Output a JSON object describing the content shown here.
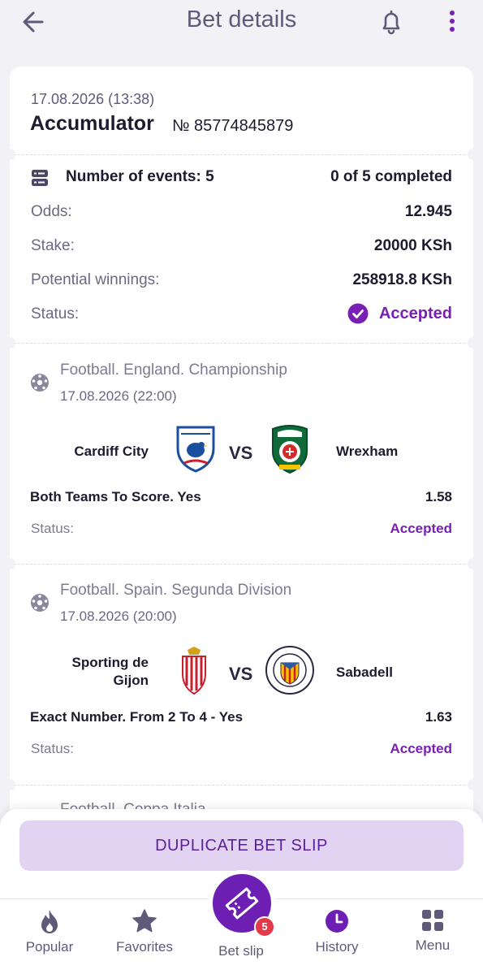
{
  "header": {
    "title": "Bet details"
  },
  "bet": {
    "datetime": "17.08.2026 (13:38)",
    "type": "Accumulator",
    "number": "№ 85774845879",
    "events_label": "Number of events: 5",
    "completed": "0 of 5 completed",
    "rows": [
      {
        "label": "Odds:",
        "value": "12.945"
      },
      {
        "label": "Stake:",
        "value": "20000 KSh"
      },
      {
        "label": "Potential winnings:",
        "value": "258918.8 KSh"
      }
    ],
    "status_label": "Status:",
    "status_value": "Accepted"
  },
  "events": [
    {
      "league": "Football. England. Championship",
      "date": "17.08.2026 (22:00)",
      "home": "Cardiff City",
      "away": "Wrexham",
      "vs": "VS",
      "market": "Both Teams To Score. Yes",
      "odd": "1.58",
      "status_label": "Status:",
      "status_value": "Accepted",
      "home_logo_text": "CARDIFF CITY FC",
      "away_logo_text": "WREXHAM"
    },
    {
      "league": "Football. Spain. Segunda Division",
      "date": "17.08.2026 (20:00)",
      "home_line1": "Sporting de",
      "home_line2": "Gijon",
      "away": "Sabadell",
      "vs": "VS",
      "market": "Exact Number. From 2 To 4 - Yes",
      "odd": "1.63",
      "status_label": "Status:",
      "status_value": "Accepted",
      "away_logo_text": "CENTRE D'ESPORTS SABADELL F.C."
    },
    {
      "league": "Football. Coppa Italia"
    }
  ],
  "actions": {
    "duplicate": "DUPLICATE BET SLIP"
  },
  "nav": {
    "items": [
      "Popular",
      "Favorites",
      "Bet slip",
      "History",
      "Menu"
    ],
    "active": "History",
    "badge": "5"
  },
  "colors": {
    "accent": "#6d1fb3",
    "accent_text": "#7a1fb5",
    "button_bg": "#e3d3f2",
    "badge": "#e5394a"
  }
}
